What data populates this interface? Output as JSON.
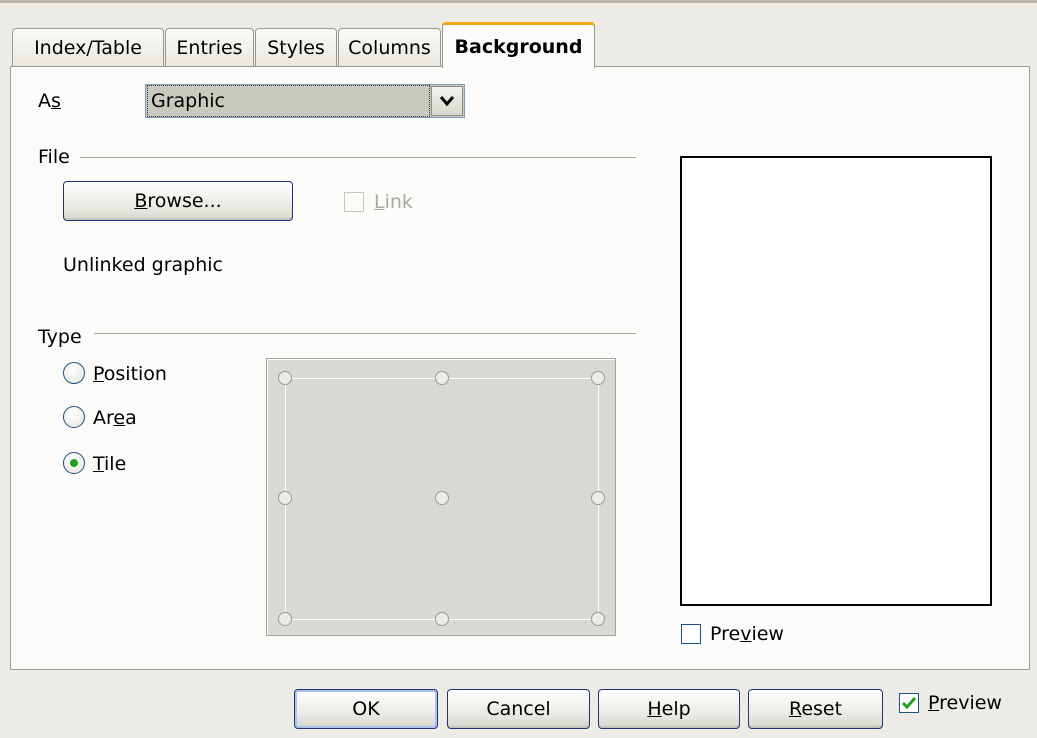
{
  "tabs": [
    {
      "label": "Index/Table"
    },
    {
      "label": "Entries"
    },
    {
      "label": "Styles"
    },
    {
      "label": "Columns"
    },
    {
      "label": "Background"
    }
  ],
  "as": {
    "label_pre": "A",
    "label_mn": "s",
    "value": "Graphic"
  },
  "file": {
    "section": "File",
    "browse_mn": "B",
    "browse_rest": "rowse...",
    "link_mn": "L",
    "link_rest": "ink",
    "link_checked": false,
    "status": "Unlinked graphic"
  },
  "type": {
    "section": "Type",
    "options": [
      {
        "mn": "P",
        "rest": "osition",
        "selected": false
      },
      {
        "pre": "Ar",
        "mn": "e",
        "post": "a",
        "selected": false
      },
      {
        "mn": "T",
        "rest": "ile",
        "selected": true
      }
    ]
  },
  "preview_panel": {
    "pre": "Pre",
    "mn": "v",
    "post": "iew",
    "checked": false
  },
  "footer": {
    "ok": "OK",
    "cancel": "Cancel",
    "help_mn": "H",
    "help_rest": "elp",
    "reset_mn": "R",
    "reset_rest": "eset",
    "preview_mn": "P",
    "preview_rest": "review",
    "preview_checked": true
  },
  "colors": {
    "active_tab_accent": "#f3a51d",
    "radio_selected": "#21a121",
    "checkmark": "#21a121"
  }
}
